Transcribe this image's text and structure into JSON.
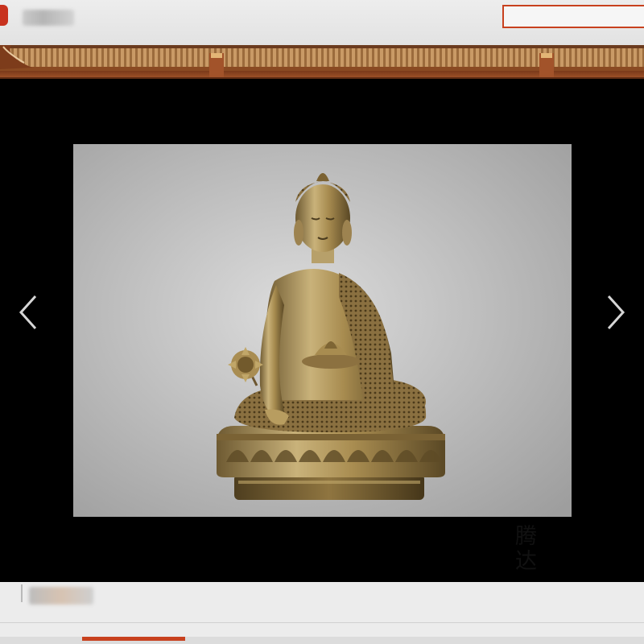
{
  "header": {
    "search_placeholder": "",
    "brand_color": "#c8321e"
  },
  "lightbox": {
    "watermark_text": "腾达",
    "prev_icon": "chevron-left-icon",
    "next_icon": "chevron-right-icon",
    "subject": "brass-buddha-statue"
  },
  "colors": {
    "accent": "#c8411e",
    "backdrop": "#000000",
    "roof_tile": "#a06a3a",
    "bronze": "#b49a5c"
  }
}
